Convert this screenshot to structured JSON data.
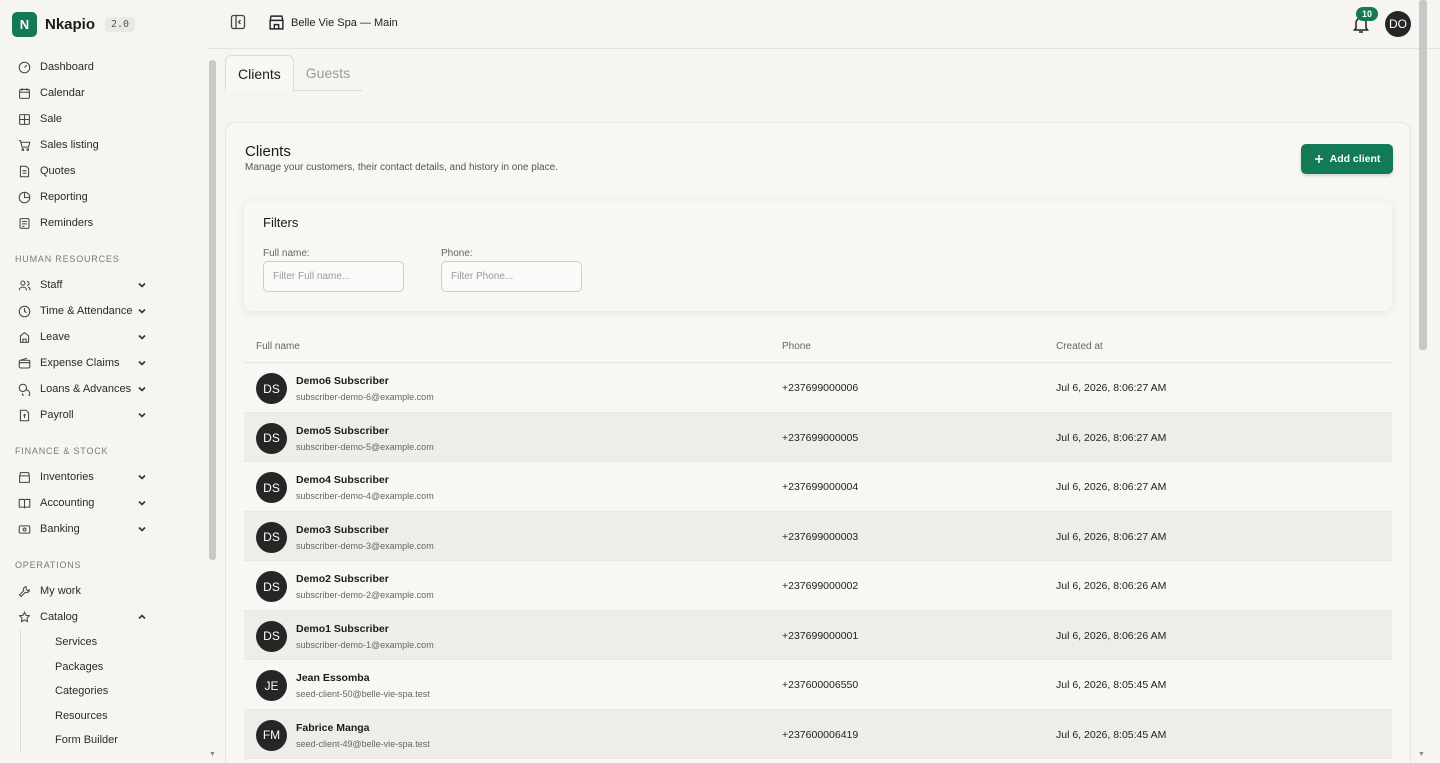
{
  "brand": {
    "logo_letter": "N",
    "name": "Nkapio",
    "version": "2.0"
  },
  "sidebar": {
    "main_items": [
      {
        "label": "Dashboard",
        "icon": "dashboard-icon"
      },
      {
        "label": "Calendar",
        "icon": "calendar-icon"
      },
      {
        "label": "Sale",
        "icon": "sale-icon"
      },
      {
        "label": "Sales listing",
        "icon": "cart-icon"
      },
      {
        "label": "Quotes",
        "icon": "document-icon"
      },
      {
        "label": "Reporting",
        "icon": "pie-chart-icon"
      },
      {
        "label": "Reminders",
        "icon": "reminder-icon"
      }
    ],
    "hr_section": "HUMAN RESOURCES",
    "hr_items": [
      {
        "label": "Staff",
        "icon": "users-icon"
      },
      {
        "label": "Time & Attendance",
        "icon": "clock-icon"
      },
      {
        "label": "Leave",
        "icon": "leave-icon"
      },
      {
        "label": "Expense Claims",
        "icon": "wallet-icon"
      },
      {
        "label": "Loans & Advances",
        "icon": "coins-icon"
      },
      {
        "label": "Payroll",
        "icon": "payroll-icon"
      }
    ],
    "finance_section": "FINANCE & STOCK",
    "finance_items": [
      {
        "label": "Inventories",
        "icon": "store-icon"
      },
      {
        "label": "Accounting",
        "icon": "book-icon"
      },
      {
        "label": "Banking",
        "icon": "bank-icon"
      }
    ],
    "ops_section": "OPERATIONS",
    "ops_items": [
      {
        "label": "My work",
        "icon": "wrench-icon"
      },
      {
        "label": "Catalog",
        "icon": "catalog-icon"
      }
    ],
    "catalog_sub": [
      "Services",
      "Packages",
      "Categories",
      "Resources",
      "Form Builder"
    ]
  },
  "header": {
    "location": "Belle Vie Spa — Main",
    "notifications": "10",
    "user_initials": "DO"
  },
  "tabs": [
    {
      "label": "Clients",
      "active": true
    },
    {
      "label": "Guests",
      "active": false
    }
  ],
  "page": {
    "title": "Clients",
    "subtitle": "Manage your customers, their contact details, and history in one place.",
    "add_button": "Add client"
  },
  "filters": {
    "title": "Filters",
    "full_name_label": "Full name:",
    "full_name_placeholder": "Filter Full name...",
    "phone_label": "Phone:",
    "phone_placeholder": "Filter Phone..."
  },
  "table": {
    "columns": [
      "Full name",
      "Phone",
      "Created at"
    ],
    "rows": [
      {
        "initials": "DS",
        "name": "Demo6 Subscriber",
        "email": "subscriber-demo-6@example.com",
        "phone": "+237699000006",
        "created": "Jul 6, 2026, 8:06:27 AM"
      },
      {
        "initials": "DS",
        "name": "Demo5 Subscriber",
        "email": "subscriber-demo-5@example.com",
        "phone": "+237699000005",
        "created": "Jul 6, 2026, 8:06:27 AM"
      },
      {
        "initials": "DS",
        "name": "Demo4 Subscriber",
        "email": "subscriber-demo-4@example.com",
        "phone": "+237699000004",
        "created": "Jul 6, 2026, 8:06:27 AM"
      },
      {
        "initials": "DS",
        "name": "Demo3 Subscriber",
        "email": "subscriber-demo-3@example.com",
        "phone": "+237699000003",
        "created": "Jul 6, 2026, 8:06:27 AM"
      },
      {
        "initials": "DS",
        "name": "Demo2 Subscriber",
        "email": "subscriber-demo-2@example.com",
        "phone": "+237699000002",
        "created": "Jul 6, 2026, 8:06:26 AM"
      },
      {
        "initials": "DS",
        "name": "Demo1 Subscriber",
        "email": "subscriber-demo-1@example.com",
        "phone": "+237699000001",
        "created": "Jul 6, 2026, 8:06:26 AM"
      },
      {
        "initials": "JE",
        "name": "Jean Essomba",
        "email": "seed-client-50@belle-vie-spa.test",
        "phone": "+237600006550",
        "created": "Jul 6, 2026, 8:05:45 AM"
      },
      {
        "initials": "FM",
        "name": "Fabrice Manga",
        "email": "seed-client-49@belle-vie-spa.test",
        "phone": "+237600006419",
        "created": "Jul 6, 2026, 8:05:45 AM"
      }
    ]
  },
  "colors": {
    "brand_green": "#127a55",
    "avatar_dark": "#262626",
    "row_alt": "#eeede8",
    "background": "#f6f5f2"
  }
}
